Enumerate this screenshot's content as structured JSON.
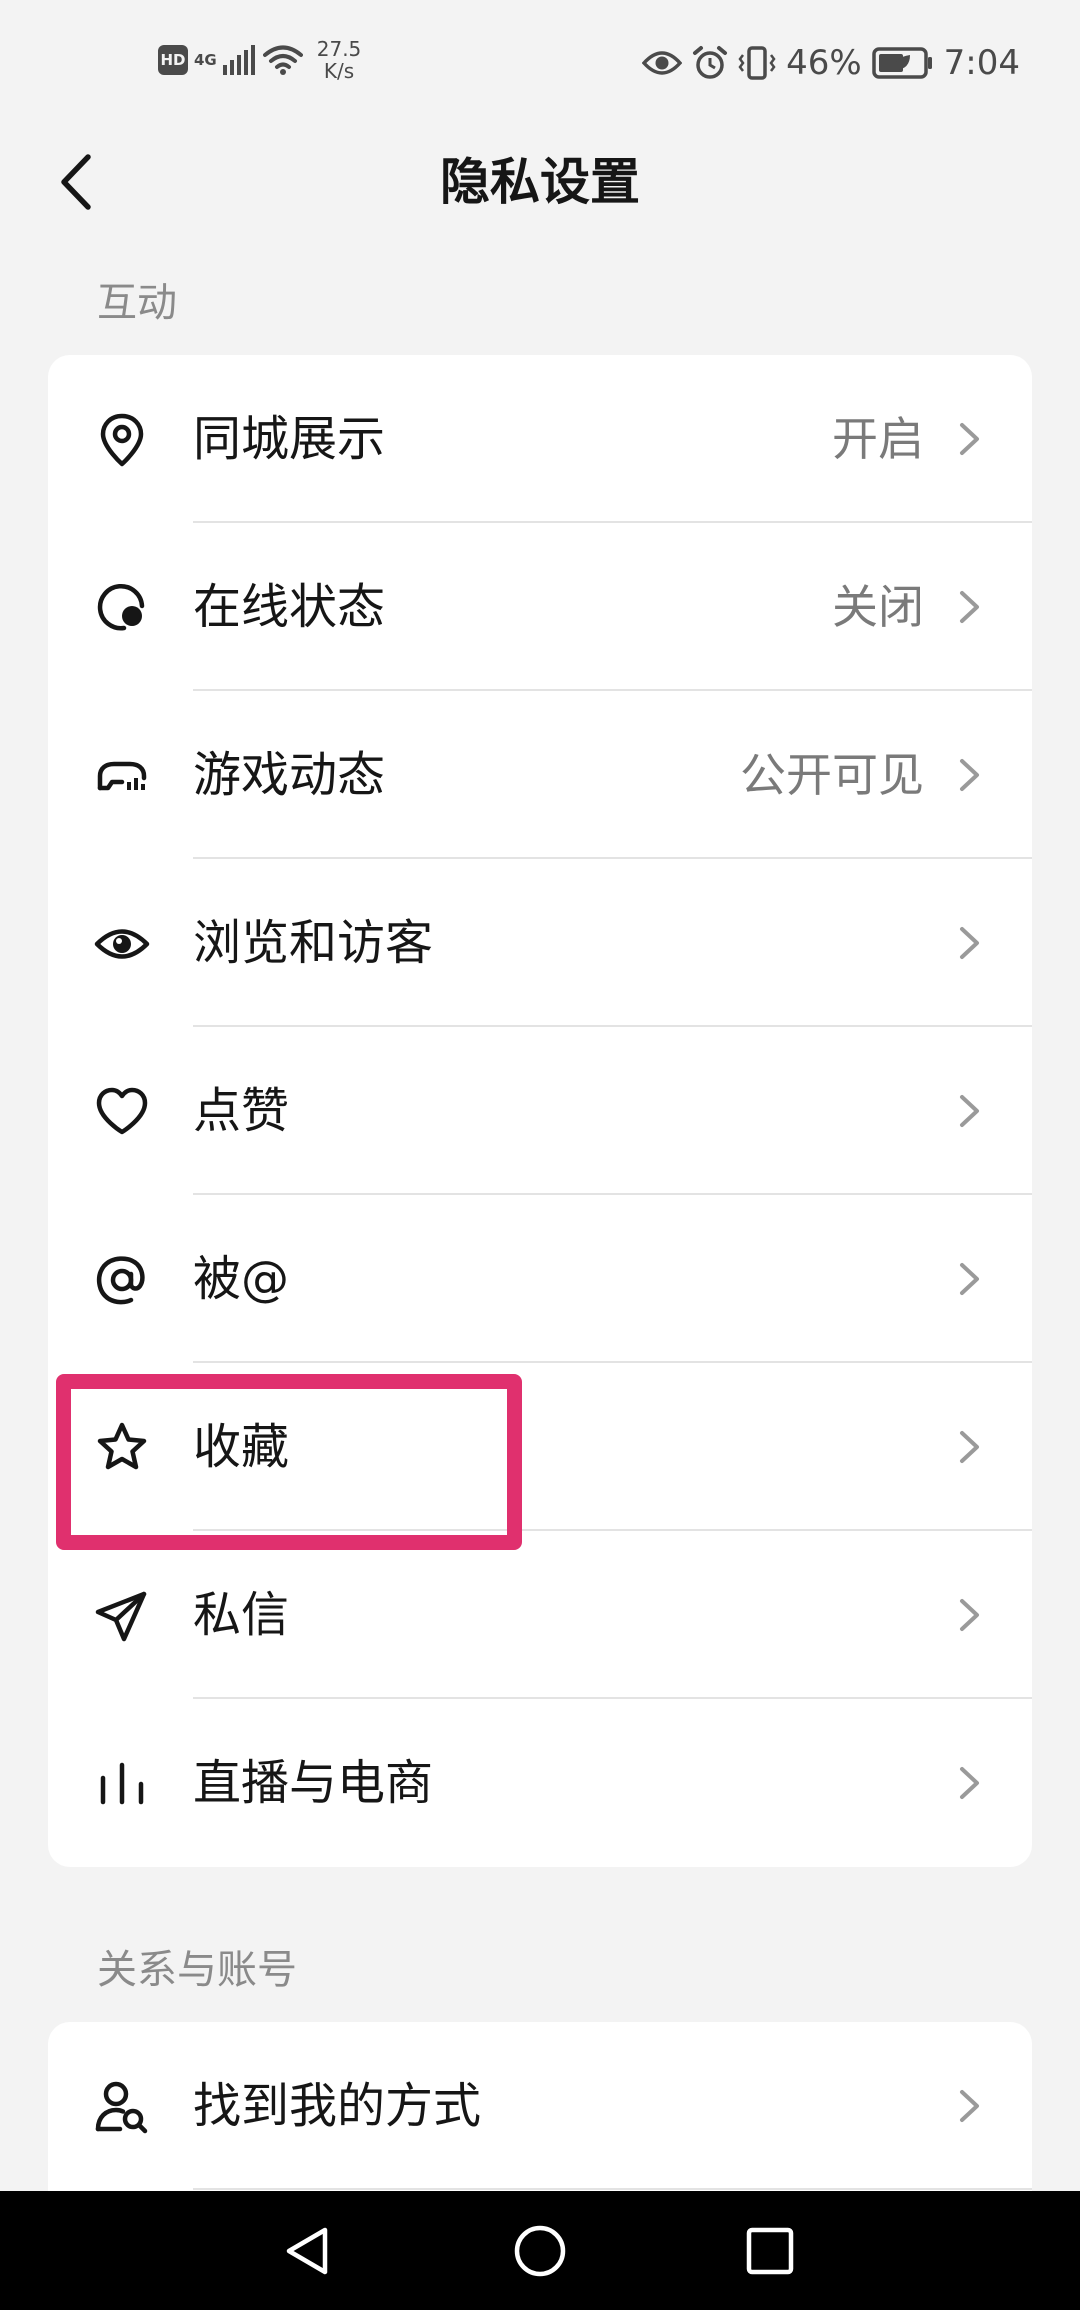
{
  "status_bar": {
    "hd": "HD",
    "network": "4G",
    "speed_value": "27.5",
    "speed_unit": "K/s",
    "battery": "46%",
    "time": "7:04"
  },
  "header": {
    "title": "隐私设置"
  },
  "sections": {
    "interaction": {
      "title": "互动",
      "items": [
        {
          "label": "同城展示",
          "value": "开启",
          "icon": "location-pin-icon"
        },
        {
          "label": "在线状态",
          "value": "关闭",
          "icon": "online-status-icon"
        },
        {
          "label": "游戏动态",
          "value": "公开可见",
          "icon": "gamepad-icon"
        },
        {
          "label": "浏览和访客",
          "value": "",
          "icon": "eye-icon"
        },
        {
          "label": "点赞",
          "value": "",
          "icon": "heart-icon"
        },
        {
          "label": "被@",
          "value": "",
          "icon": "at-icon"
        },
        {
          "label": "收藏",
          "value": "",
          "icon": "star-icon"
        },
        {
          "label": "私信",
          "value": "",
          "icon": "paper-plane-icon"
        },
        {
          "label": "直播与电商",
          "value": "",
          "icon": "bar-chart-icon"
        }
      ]
    },
    "relations": {
      "title": "关系与账号",
      "items": [
        {
          "label": "找到我的方式",
          "value": "",
          "icon": "user-search-icon"
        }
      ]
    }
  },
  "colors": {
    "highlight": "#e0306e",
    "background": "#f3f3f3"
  }
}
